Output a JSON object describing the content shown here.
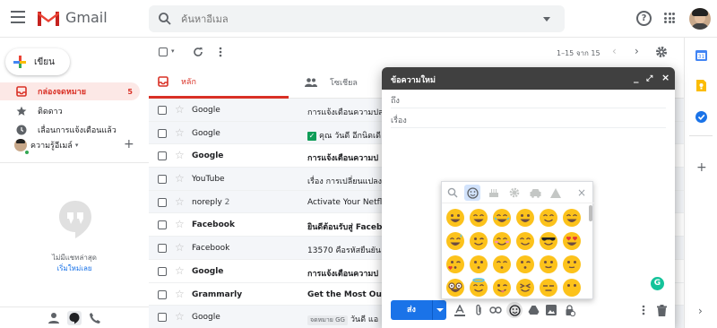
{
  "app": {
    "name": "Gmail"
  },
  "colors": {
    "accent": "#d93025",
    "primary": "#1a73e8",
    "compose_header": "#404040",
    "emoji_yellow": "#fcc21b"
  },
  "search": {
    "placeholder": "ค้นหาอีเมล"
  },
  "sidebar": {
    "compose_label": "เขียน",
    "items": [
      {
        "label": "กล่องจดหมาย",
        "count": "5",
        "icon": "inbox-icon",
        "active": true
      },
      {
        "label": "ติดดาว",
        "icon": "star-icon"
      },
      {
        "label": "เลื่อนการแจ้งเตือนแล้ว",
        "icon": "clock-icon"
      }
    ],
    "chat_user": "ความรู้อีเมล์",
    "no_recent_chats": "ไม่มีแชทล่าสุด",
    "start_new": "เริ่มใหม่เลย"
  },
  "toolbar": {
    "pagination": "1–15 จาก 15"
  },
  "tabs": [
    {
      "label": "หลัก",
      "icon": "inbox-icon",
      "active": true
    },
    {
      "label": "โซเชียล",
      "icon": "people-icon"
    }
  ],
  "emails": [
    {
      "from": "Google",
      "subject": "การแจ้งเตือนความปลอ",
      "bold": false
    },
    {
      "from": "Google",
      "subject": "คุณ วันดี อีกนิดเดี",
      "bold": false,
      "badge": "✓"
    },
    {
      "from": "Google",
      "subject": "การแจ้งเตือนความป",
      "bold": true
    },
    {
      "from": "YouTube",
      "subject": "เรื่อง การเปลี่ยนแปลง",
      "bold": false
    },
    {
      "from": "noreply",
      "count": "2",
      "subject": "Activate Your Netflix",
      "bold": false
    },
    {
      "from": "Facebook",
      "subject": "ยินดีต้อนรับสู่ Facebo",
      "bold": true
    },
    {
      "from": "Facebook",
      "subject": "13570 คือรหัสยืนยัน F",
      "bold": false
    },
    {
      "from": "Google",
      "subject": "การแจ้งเตือนความป",
      "bold": true
    },
    {
      "from": "Grammarly",
      "subject": "Get the Most Out of",
      "bold": true
    },
    {
      "from": "Google",
      "tag": "จดหมาย GG",
      "subject": "วันดี แอ",
      "bold": false
    }
  ],
  "composer": {
    "title": "ข้อความใหม่",
    "to_label": "ถึง",
    "subject_placeholder": "เรื่อง",
    "send_label": "ส่ง"
  },
  "emoji_picker": {
    "tabs": [
      "search-icon",
      "smiley-icon",
      "cake-icon",
      "gear-icon",
      "car-icon",
      "triangle-icon",
      "close-icon"
    ],
    "emojis": [
      "grinning",
      "beaming",
      "laughing",
      "smile-open",
      "smile-closed",
      "grin-closed",
      "laugh-sweat",
      "wink",
      "blush",
      "smile",
      "sunglasses",
      "heart-eyes",
      "kiss-heart",
      "kissing",
      "kiss-closed",
      "kiss-wink",
      "slight-smile",
      "neutral-smile",
      "nerd",
      "angel",
      "tongue",
      "squint",
      "expressionless",
      "no-mouth"
    ]
  }
}
